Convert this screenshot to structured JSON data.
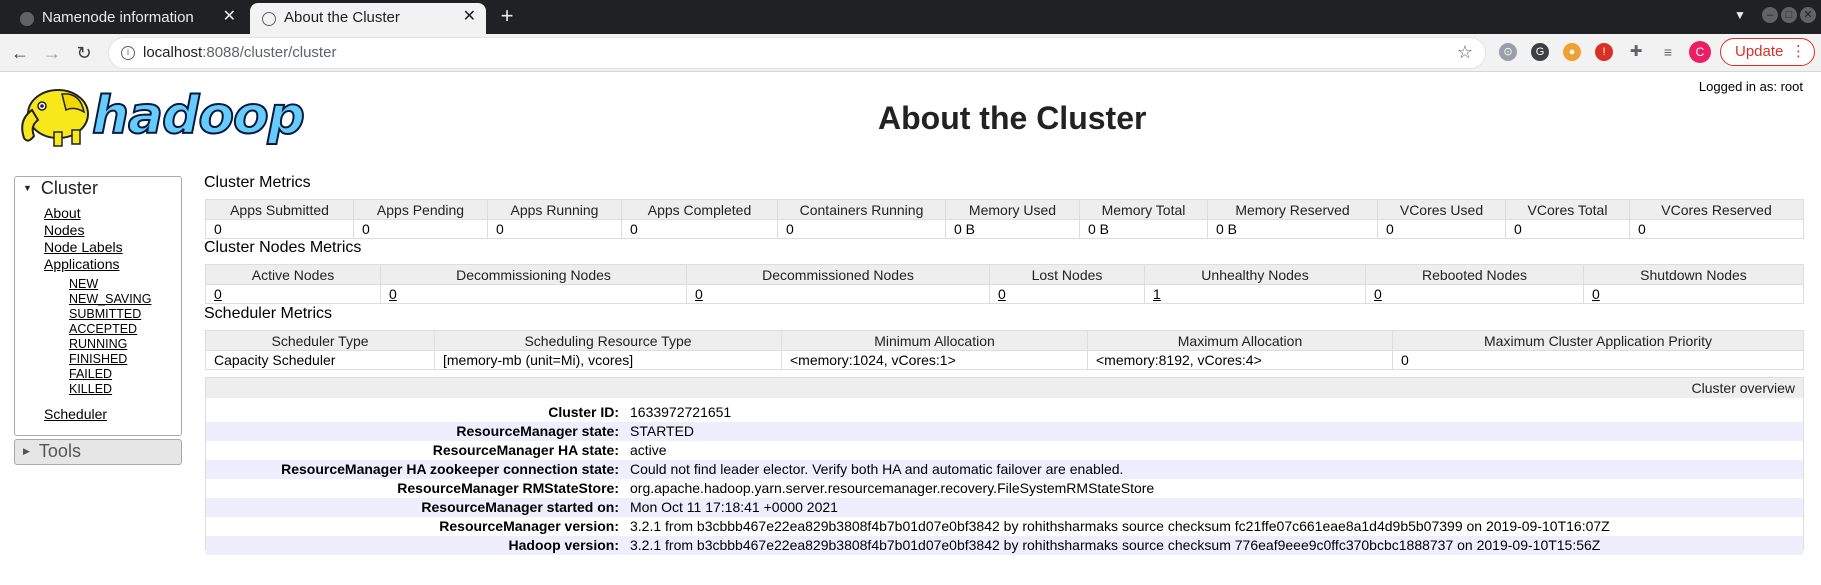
{
  "browser": {
    "tabs": [
      {
        "title": "Namenode information"
      },
      {
        "title": "About the Cluster"
      }
    ],
    "url_host": "localhost",
    "url_rest": ":8088/cluster/cluster",
    "update_label": "Update",
    "profile_initial": "C"
  },
  "header": {
    "logo_text": "hadoop",
    "logged_in": "Logged in as: root",
    "title": "About the Cluster"
  },
  "sidebar": {
    "cluster_heading": "Cluster",
    "links": [
      "About",
      "Nodes",
      "Node Labels",
      "Applications"
    ],
    "app_states": [
      "NEW",
      "NEW_SAVING",
      "SUBMITTED",
      "ACCEPTED",
      "RUNNING",
      "FINISHED",
      "FAILED",
      "KILLED"
    ],
    "scheduler": "Scheduler",
    "tools_heading": "Tools"
  },
  "cluster_metrics": {
    "title": "Cluster Metrics",
    "headers": [
      "Apps Submitted",
      "Apps Pending",
      "Apps Running",
      "Apps Completed",
      "Containers Running",
      "Memory Used",
      "Memory Total",
      "Memory Reserved",
      "VCores Used",
      "VCores Total",
      "VCores Reserved"
    ],
    "values": [
      "0",
      "0",
      "0",
      "0",
      "0",
      "0 B",
      "0 B",
      "0 B",
      "0",
      "0",
      "0"
    ]
  },
  "node_metrics": {
    "title": "Cluster Nodes Metrics",
    "headers": [
      "Active Nodes",
      "Decommissioning Nodes",
      "Decommissioned Nodes",
      "Lost Nodes",
      "Unhealthy Nodes",
      "Rebooted Nodes",
      "Shutdown Nodes"
    ],
    "values": [
      "0",
      "0",
      "0",
      "0",
      "1",
      "0",
      "0"
    ]
  },
  "scheduler_metrics": {
    "title": "Scheduler Metrics",
    "headers": [
      "Scheduler Type",
      "Scheduling Resource Type",
      "Minimum Allocation",
      "Maximum Allocation",
      "Maximum Cluster Application Priority"
    ],
    "values": [
      "Capacity Scheduler",
      "[memory-mb (unit=Mi), vcores]",
      "<memory:1024, vCores:1>",
      "<memory:8192, vCores:4>",
      "0"
    ]
  },
  "overview": {
    "heading": "Cluster overview",
    "rows": [
      {
        "label": "Cluster ID:",
        "value": "1633972721651"
      },
      {
        "label": "ResourceManager state:",
        "value": "STARTED"
      },
      {
        "label": "ResourceManager HA state:",
        "value": "active"
      },
      {
        "label": "ResourceManager HA zookeeper connection state:",
        "value": "Could not find leader elector. Verify both HA and automatic failover are enabled."
      },
      {
        "label": "ResourceManager RMStateStore:",
        "value": "org.apache.hadoop.yarn.server.resourcemanager.recovery.FileSystemRMStateStore"
      },
      {
        "label": "ResourceManager started on:",
        "value": "Mon Oct 11 17:18:41 +0000 2021"
      },
      {
        "label": "ResourceManager version:",
        "value": "3.2.1 from b3cbbb467e22ea829b3808f4b7b01d07e0bf3842 by rohithsharmaks source checksum fc21ffe07c661eae8a1d4d9b5b07399 on 2019-09-10T16:07Z"
      },
      {
        "label": "Hadoop version:",
        "value": "3.2.1 from b3cbbb467e22ea829b3808f4b7b01d07e0bf3842 by rohithsharmaks source checksum 776eaf9eee9c0ffc370bcbc1888737 on 2019-09-10T15:56Z"
      }
    ]
  }
}
